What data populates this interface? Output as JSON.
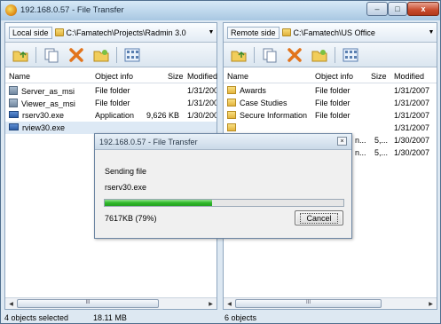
{
  "window": {
    "title": "192.168.0.57 - File Transfer",
    "minimize_label": "–",
    "maximize_label": "□",
    "close_label": "x"
  },
  "left_pane": {
    "side_label": "Local side",
    "path": "C:\\Famatech\\Projects\\Radmin 3.0",
    "columns": [
      "Name",
      "Object info",
      "Size",
      "Modified"
    ],
    "rows": [
      {
        "name": "Server_as_msi",
        "info": "File folder",
        "size": "",
        "modified": "1/31/200",
        "icon": "folder-package-icon"
      },
      {
        "name": "Viewer_as_msi",
        "info": "File folder",
        "size": "",
        "modified": "1/31/200",
        "icon": "folder-package-icon"
      },
      {
        "name": "rserv30.exe",
        "info": "Application",
        "size": "9,626 KB",
        "modified": "1/30/200",
        "icon": "exe-icon"
      },
      {
        "name": "rview30.exe",
        "info": "",
        "size": "",
        "modified": "",
        "icon": "exe-icon"
      }
    ],
    "scroll_thumb_label": "III"
  },
  "right_pane": {
    "side_label": "Remote side",
    "path": "C:\\Famatech\\US Office",
    "columns": [
      "Name",
      "Object info",
      "Size",
      "Modified"
    ],
    "rows": [
      {
        "name": "Awards",
        "info": "File folder",
        "size": "",
        "modified": "1/31/2007",
        "icon": "folder-icon"
      },
      {
        "name": "Case Studies",
        "info": "File folder",
        "size": "",
        "modified": "1/31/2007",
        "icon": "folder-icon"
      },
      {
        "name": "Secure Information",
        "info": "File folder",
        "size": "",
        "modified": "1/31/2007",
        "icon": "folder-icon"
      },
      {
        "name": "",
        "info": "",
        "size": "",
        "modified": "1/31/2007",
        "icon": "folder-icon"
      },
      {
        "name": "",
        "info": "n...",
        "size": "5,...",
        "modified": "1/30/2007",
        "icon": ""
      },
      {
        "name": "",
        "info": "n...",
        "size": "5,...",
        "modified": "1/30/2007",
        "icon": ""
      }
    ],
    "scroll_thumb_label": "III"
  },
  "status": {
    "left_selected": "4 objects selected",
    "left_size": "18.11 MB",
    "right_count": "6 objects"
  },
  "dialog": {
    "title": "192.168.0.57 - File Transfer",
    "close_label": "×",
    "line1": "Sending file",
    "line2": "rserv30.exe",
    "progress_percent": 0.45,
    "size_text": "7617KB (79%)",
    "cancel_label": "Cancel"
  },
  "colors": {
    "progress": "#2fb82a",
    "selection": "#dde9f5"
  }
}
